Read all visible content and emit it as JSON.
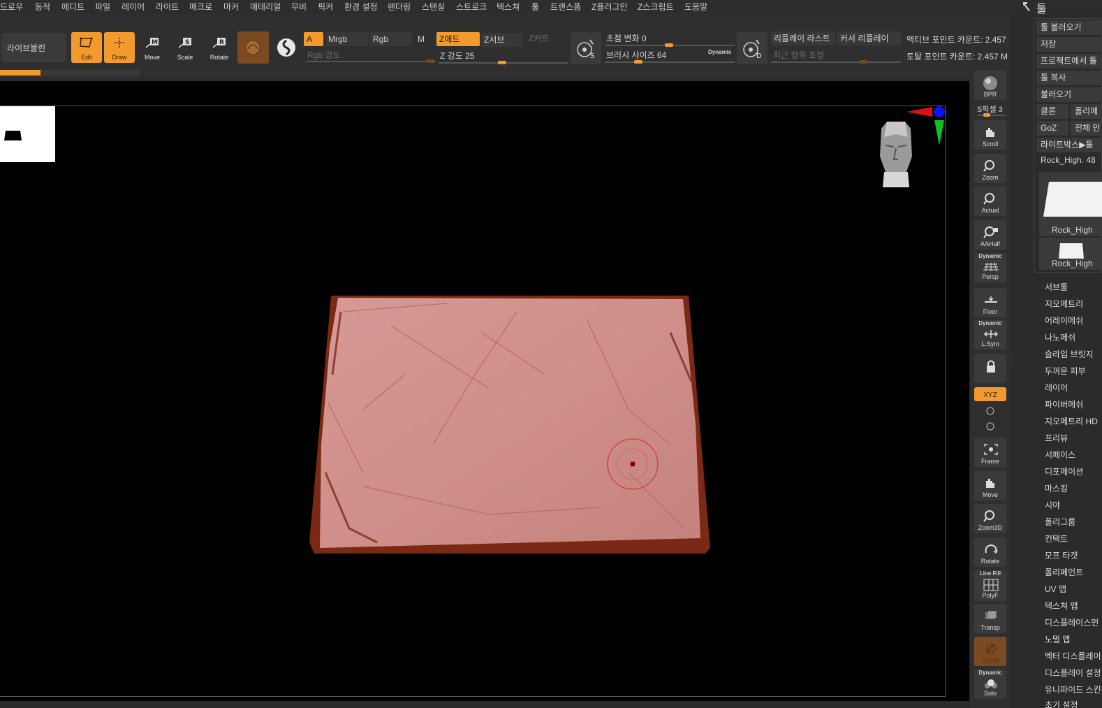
{
  "menu": [
    "드로우",
    "동적",
    "에디트",
    "파일",
    "레이어",
    "라이트",
    "매크로",
    "마커",
    "매테리얼",
    "무비",
    "픽커",
    "환경 설정",
    "렌더링",
    "스텐실",
    "스트로크",
    "텍스쳐",
    "툴",
    "트랜스폼",
    "Z플러그인",
    "Z스크립트",
    "도움말"
  ],
  "tool_title": "툴",
  "shelf": {
    "livebool": "라이브불린",
    "edit": "Edit",
    "draw": "Draw",
    "move": "Move",
    "scale": "Scale",
    "rotate": "Rotate",
    "a_label": "A",
    "mrgb": "Mrgb",
    "rgb": "Rgb",
    "m": "M",
    "zadd": "Z애드",
    "zsub": "Z서브",
    "zcut": "Z커트",
    "rgb_intensity": "Rgb 강도",
    "z_intensity": "Z 강도 25",
    "focal_shift": "초점 변화 0",
    "brush_size": "브러시 사이즈 64",
    "dynamic": "Dynamic",
    "replay_last": "리플레이 라스트",
    "cursor_replay": "커서 리플레이",
    "recent_adjust": "최근 항목 조정",
    "active_points": "액티브 포인트 카운트: 2.457",
    "total_points": "토탈 포인트 카운트: 2.457 M",
    "s_label": "S",
    "d_label": "D"
  },
  "navcol": {
    "bpr": "BPR",
    "spix": "S픽셀 3",
    "scroll": "Scroll",
    "zoom": "Zoom",
    "actual": "Actual",
    "aahalf": "AAHalf",
    "persp_top": "Dynamic",
    "persp": "Persp",
    "floor": "Floor",
    "lsym_top": "Dynamic",
    "lsym": "L.Sym",
    "xyz": "XYZ",
    "frame": "Frame",
    "move": "Move",
    "zoom3d": "Zoom3D",
    "rotate": "Rotate",
    "polyf_top": "Line Fill",
    "polyf": "PolyF",
    "transp": "Transp",
    "ghost": "Ghost",
    "solo_top": "Dynamic",
    "solo": "Solo"
  },
  "toolpanel": {
    "load_tool": "툴 불러오기",
    "save": "저장",
    "from_project": "프로젝트에서 툴",
    "copy_tool": "툴 복사",
    "import": "불러오기",
    "clone": "클론",
    "polymesh": "폴리메",
    "goz": "GoZ",
    "all": "전체 인",
    "lightbox_tools": "라이트박스▶툴",
    "current_tool": "Rock_High. 48",
    "thumb1": "Rock_High",
    "thumb2": "Rock_High",
    "items": [
      "서브툴",
      "지오메트리",
      "어레이메쉬",
      "나노메쉬",
      "슬라임 브릿지",
      "두꺼운 피부",
      "레이어",
      "파이버메쉬",
      "지오메트리 HD",
      "프리뷰",
      "서페이스",
      "디포메이션",
      "마스킹",
      "시야",
      "폴리그룹",
      "컨택트",
      "모프 타겟",
      "폴리페인트",
      "UV 맵",
      "텍스쳐 맵",
      "디스플레이스먼",
      "노멀 맵",
      "벡터 디스플레이",
      "디스플레이 설정",
      "유니파이드 스킨",
      "초기 설정"
    ]
  },
  "colors": {
    "accent": "#f29a2e",
    "mesh": "#c98a85",
    "mesh_edge": "#7a2a14"
  }
}
